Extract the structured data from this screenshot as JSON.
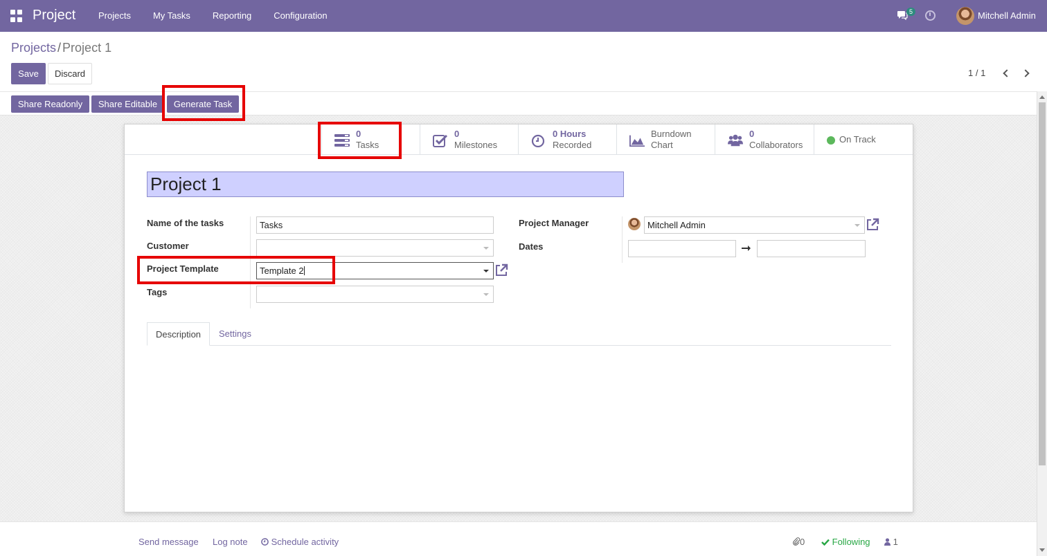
{
  "navbar": {
    "brand": "Project",
    "menu": [
      "Projects",
      "My Tasks",
      "Reporting",
      "Configuration"
    ],
    "chat_count": "5",
    "user_name": "Mitchell Admin",
    "color": "#7266a0"
  },
  "breadcrumb": {
    "parent": "Projects",
    "separator": "/",
    "current": "Project 1"
  },
  "control": {
    "save_label": "Save",
    "discard_label": "Discard",
    "pager": "1 / 1"
  },
  "statusbar": {
    "share_readonly": "Share Readonly",
    "share_editable": "Share Editable",
    "generate_task": "Generate Task"
  },
  "smart_buttons": [
    {
      "value": "0",
      "label": "Tasks",
      "icon": "tasks-icon"
    },
    {
      "value": "0",
      "label": "Milestones",
      "icon": "check-square-icon"
    },
    {
      "value": "0 Hours",
      "label": "Recorded",
      "icon": "clock-icon"
    },
    {
      "value": "Burndown",
      "label": "Chart",
      "icon": "area-chart-icon"
    },
    {
      "value": "0",
      "label": "Collaborators",
      "icon": "users-icon"
    },
    {
      "label": "On Track",
      "icon": "status-dot-icon",
      "color": "#5cb85c"
    }
  ],
  "form": {
    "name": "Project 1",
    "fields": {
      "task_name_label": "Name of the tasks",
      "task_name_value": "Tasks",
      "customer_label": "Customer",
      "customer_value": "",
      "template_label": "Project Template",
      "template_value": "Template 2",
      "tags_label": "Tags",
      "tags_value": "",
      "manager_label": "Project Manager",
      "manager_value": "Mitchell Admin",
      "dates_label": "Dates",
      "date_start": "",
      "date_end": ""
    },
    "tabs": [
      "Description",
      "Settings"
    ]
  },
  "chatter": {
    "send_message": "Send message",
    "log_note": "Log note",
    "schedule_activity": "Schedule activity",
    "attachments": "0",
    "following": "Following",
    "followers": "1"
  },
  "highlight_color": "#e60000"
}
